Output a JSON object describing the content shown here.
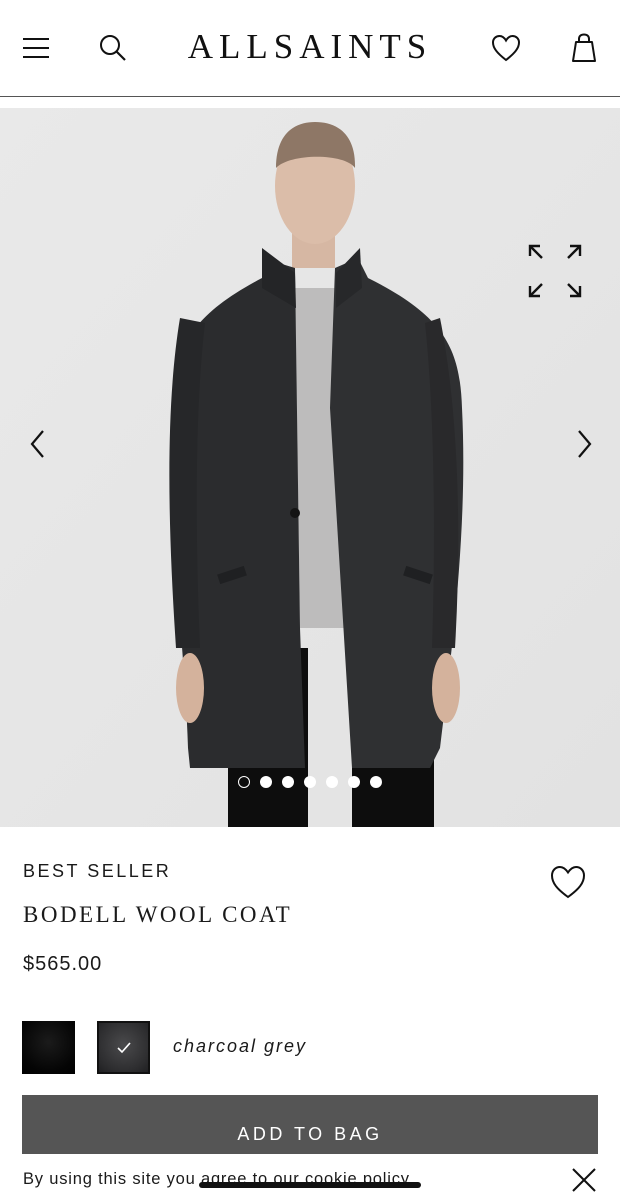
{
  "header": {
    "brand": "ALLSAINTS",
    "icons": [
      "menu-icon",
      "search-icon",
      "heart-icon",
      "bag-icon"
    ]
  },
  "gallery": {
    "image": "model wearing charcoal wool coat over grey t-shirt",
    "image_count": 7,
    "active_index": 0,
    "icons": [
      "expand-icon",
      "chevron-left-icon",
      "chevron-right-icon"
    ]
  },
  "product": {
    "badge": "BEST SELLER",
    "title": "BODELL WOOL COAT",
    "price": "$565.00",
    "color_name": "charcoal grey",
    "swatches": [
      {
        "name": "black",
        "color": "#0a0a0a",
        "selected": false
      },
      {
        "name": "charcoal grey",
        "color": "#3a3a3c",
        "selected": true
      }
    ]
  },
  "actions": {
    "add_to_bag": "ADD TO BAG"
  },
  "cookie": {
    "text": "By using this site you ",
    "link": "agree to our cookie policy",
    "suffix": "."
  },
  "colors": {
    "button_bg": "#555555",
    "gallery_bg": "#e6e6e6",
    "text": "#1a1a1a"
  }
}
